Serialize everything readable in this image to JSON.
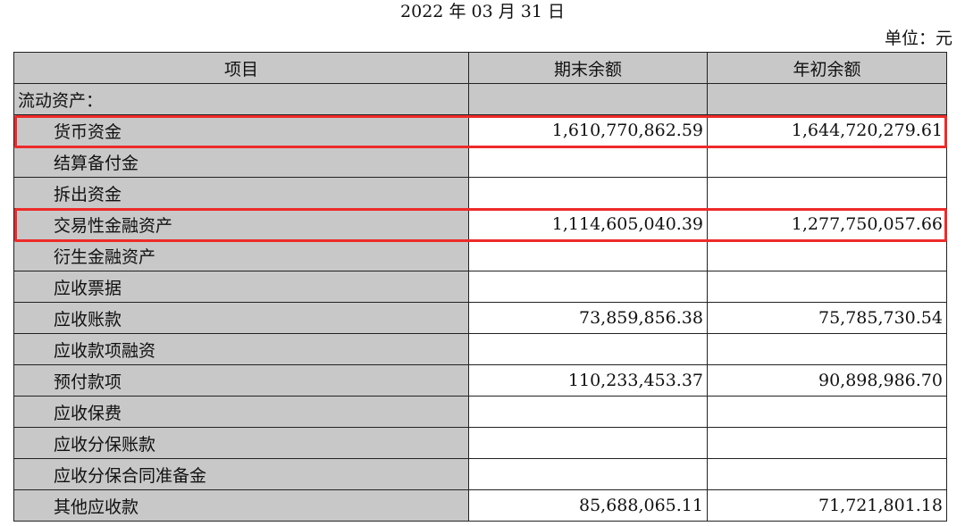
{
  "header": {
    "date": "2022 年 03 月 31 日",
    "unit": "单位：元"
  },
  "table": {
    "columns": [
      "项目",
      "期末余额",
      "年初余额"
    ],
    "rows": [
      {
        "item": "流动资产：",
        "end": "",
        "begin": ""
      },
      {
        "item": "货币资金",
        "end": "1,610,770,862.59",
        "begin": "1,644,720,279.61"
      },
      {
        "item": "结算备付金",
        "end": "",
        "begin": ""
      },
      {
        "item": "拆出资金",
        "end": "",
        "begin": ""
      },
      {
        "item": "交易性金融资产",
        "end": "1,114,605,040.39",
        "begin": "1,277,750,057.66"
      },
      {
        "item": "衍生金融资产",
        "end": "",
        "begin": ""
      },
      {
        "item": "应收票据",
        "end": "",
        "begin": ""
      },
      {
        "item": "应收账款",
        "end": "73,859,856.38",
        "begin": "75,785,730.54"
      },
      {
        "item": "应收款项融资",
        "end": "",
        "begin": ""
      },
      {
        "item": "预付款项",
        "end": "110,233,453.37",
        "begin": "90,898,986.70"
      },
      {
        "item": "应收保费",
        "end": "",
        "begin": ""
      },
      {
        "item": "应收分保账款",
        "end": "",
        "begin": ""
      },
      {
        "item": "应收分保合同准备金",
        "end": "",
        "begin": ""
      },
      {
        "item": "其他应收款",
        "end": "85,688,065.11",
        "begin": "71,721,801.18"
      }
    ]
  },
  "colors": {
    "header_fill": "#c8c8c8",
    "highlight_border": "#ee2a2a"
  }
}
